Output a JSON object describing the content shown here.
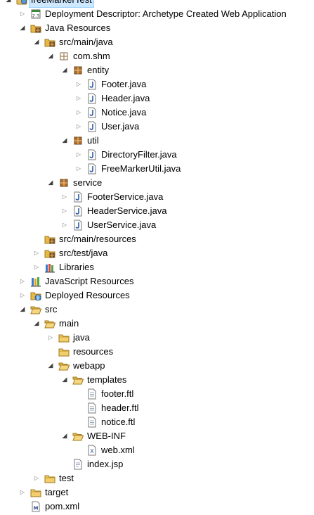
{
  "tree": [
    {
      "label": "freeMarkerTest",
      "icon": "web-project-icon",
      "depth": 0,
      "twisty": "open",
      "selected": true
    },
    {
      "label": "Deployment Descriptor: Archetype Created Web Application",
      "icon": "deployment-descriptor-icon",
      "depth": 1,
      "twisty": "closed"
    },
    {
      "label": "Java Resources",
      "icon": "java-resources-icon",
      "depth": 1,
      "twisty": "open"
    },
    {
      "label": "src/main/java",
      "icon": "source-folder-icon",
      "depth": 2,
      "twisty": "open"
    },
    {
      "label": "com.shm",
      "icon": "package-empty-icon",
      "depth": 3,
      "twisty": "open"
    },
    {
      "label": "entity",
      "icon": "package-icon",
      "depth": 4,
      "twisty": "open"
    },
    {
      "label": "Footer.java",
      "icon": "java-file-icon",
      "depth": 5,
      "twisty": "closed"
    },
    {
      "label": "Header.java",
      "icon": "java-file-icon",
      "depth": 5,
      "twisty": "closed"
    },
    {
      "label": "Notice.java",
      "icon": "java-file-icon",
      "depth": 5,
      "twisty": "closed"
    },
    {
      "label": "User.java",
      "icon": "java-file-icon",
      "depth": 5,
      "twisty": "closed"
    },
    {
      "label": "util",
      "icon": "package-icon",
      "depth": 4,
      "twisty": "open"
    },
    {
      "label": "DirectoryFilter.java",
      "icon": "java-file-icon",
      "depth": 5,
      "twisty": "closed"
    },
    {
      "label": "FreeMarkerUtil.java",
      "icon": "java-file-icon",
      "depth": 5,
      "twisty": "closed"
    },
    {
      "label": "service",
      "icon": "package-icon",
      "depth": 3,
      "twisty": "open"
    },
    {
      "label": "FooterService.java",
      "icon": "java-file-icon",
      "depth": 4,
      "twisty": "closed"
    },
    {
      "label": "HeaderService.java",
      "icon": "java-file-icon",
      "depth": 4,
      "twisty": "closed"
    },
    {
      "label": "UserService.java",
      "icon": "java-file-icon",
      "depth": 4,
      "twisty": "closed"
    },
    {
      "label": "src/main/resources",
      "icon": "source-folder-icon",
      "depth": 2,
      "twisty": "none"
    },
    {
      "label": "src/test/java",
      "icon": "source-folder-icon",
      "depth": 2,
      "twisty": "closed"
    },
    {
      "label": "Libraries",
      "icon": "libraries-icon",
      "depth": 2,
      "twisty": "closed"
    },
    {
      "label": "JavaScript Resources",
      "icon": "javascript-resources-icon",
      "depth": 1,
      "twisty": "closed"
    },
    {
      "label": "Deployed Resources",
      "icon": "deployed-resources-icon",
      "depth": 1,
      "twisty": "closed"
    },
    {
      "label": "src",
      "icon": "folder-open-icon",
      "depth": 1,
      "twisty": "open"
    },
    {
      "label": "main",
      "icon": "folder-open-icon",
      "depth": 2,
      "twisty": "open"
    },
    {
      "label": "java",
      "icon": "folder-icon",
      "depth": 3,
      "twisty": "closed"
    },
    {
      "label": "resources",
      "icon": "folder-icon",
      "depth": 3,
      "twisty": "none"
    },
    {
      "label": "webapp",
      "icon": "folder-open-icon",
      "depth": 3,
      "twisty": "open"
    },
    {
      "label": "templates",
      "icon": "folder-open-icon",
      "depth": 4,
      "twisty": "open"
    },
    {
      "label": "footer.ftl",
      "icon": "text-file-icon",
      "depth": 5,
      "twisty": "none"
    },
    {
      "label": "header.ftl",
      "icon": "text-file-icon",
      "depth": 5,
      "twisty": "none"
    },
    {
      "label": "notice.ftl",
      "icon": "text-file-icon",
      "depth": 5,
      "twisty": "none"
    },
    {
      "label": "WEB-INF",
      "icon": "folder-open-icon",
      "depth": 4,
      "twisty": "open"
    },
    {
      "label": "web.xml",
      "icon": "xml-file-icon",
      "depth": 5,
      "twisty": "none"
    },
    {
      "label": "index.jsp",
      "icon": "jsp-file-icon",
      "depth": 4,
      "twisty": "none"
    },
    {
      "label": "test",
      "icon": "folder-icon",
      "depth": 2,
      "twisty": "closed"
    },
    {
      "label": "target",
      "icon": "folder-icon",
      "depth": 1,
      "twisty": "closed"
    },
    {
      "label": "pom.xml",
      "icon": "maven-pom-icon",
      "depth": 1,
      "twisty": "none"
    }
  ],
  "colors": {
    "selection": "#cde8ff",
    "folder": "#e8b844",
    "java_file": "#2a5caa",
    "package": "#b0702a"
  }
}
